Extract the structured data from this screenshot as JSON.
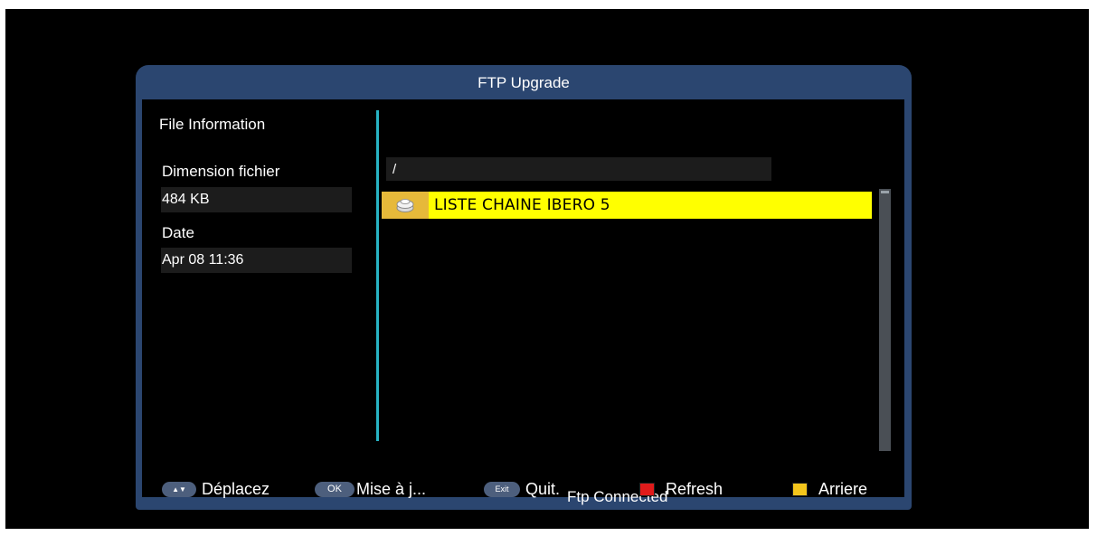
{
  "window": {
    "title": "FTP Upgrade"
  },
  "info": {
    "heading": "File Information",
    "size_label": "Dimension fichier",
    "size_value": "484 KB",
    "date_label": "Date",
    "date_value": "Apr 08 11:36"
  },
  "browser": {
    "path": "/",
    "files": [
      {
        "name": "LISTE CHAINE IBERO 5",
        "icon": "file-stack-icon"
      }
    ],
    "status": "Ftp Connected"
  },
  "footer": {
    "move_key": "▲▼",
    "move_label": "Déplacez",
    "ok_key": "OK",
    "ok_label": "Mise à j...",
    "exit_key": "Exit",
    "exit_label": "Quit.",
    "red_label": "Refresh",
    "yellow_label": "Arriere",
    "red_color": "#e01b1b",
    "yellow_color": "#f3c51c"
  }
}
